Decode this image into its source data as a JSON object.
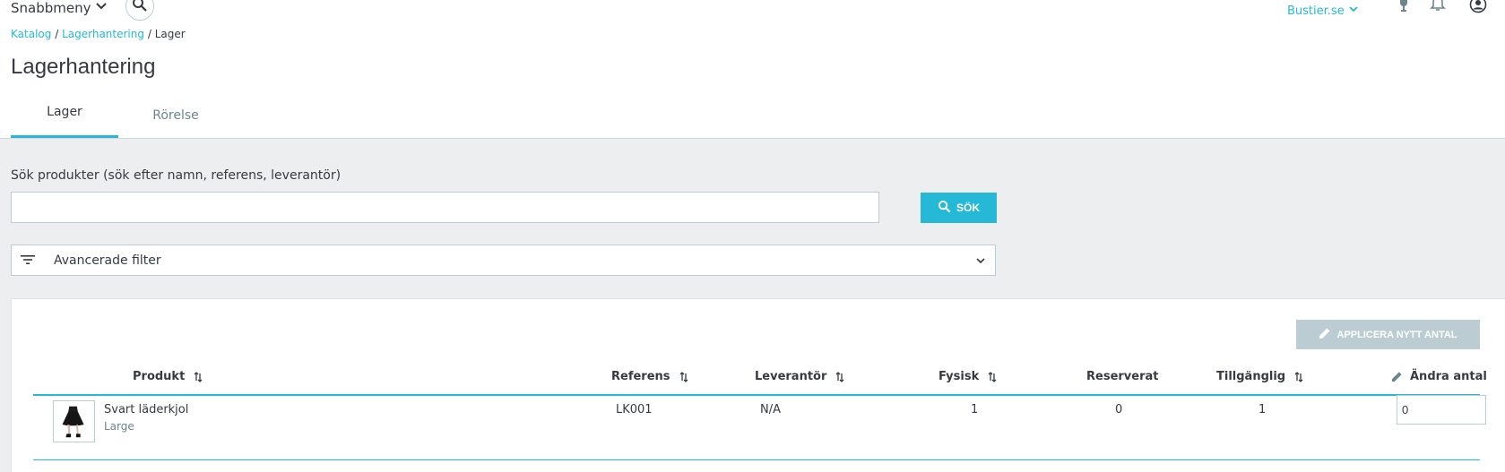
{
  "header": {
    "quick_menu_label": "Snabbmeny",
    "shop_name": "Bustier.se"
  },
  "breadcrumb": {
    "item1": "Katalog",
    "item2": "Lagerhantering",
    "current": "Lager",
    "separator": "/"
  },
  "page": {
    "title": "Lagerhantering"
  },
  "tabs": [
    {
      "label": "Lager",
      "active": true
    },
    {
      "label": "Rörelse",
      "active": false
    }
  ],
  "search": {
    "label": "Sök produkter (sök efter namn, referens, leverantör)",
    "value": "",
    "placeholder": "",
    "button_label": "Sök"
  },
  "filter": {
    "label": "Avancerade filter"
  },
  "actions": {
    "apply_label": "APPLICERA NYTT ANTAL"
  },
  "table": {
    "columns": {
      "product": "Produkt",
      "reference": "Referens",
      "supplier": "Leverantör",
      "physical": "Fysisk",
      "reserved": "Reserverat",
      "available": "Tillgänglig",
      "edit_qty": "Ändra antal"
    },
    "rows": [
      {
        "name": "Svart läderkjol",
        "attribute": "Large",
        "reference": "LK001",
        "supplier": "N/A",
        "physical": "1",
        "reserved": "0",
        "available": "1",
        "new_qty": "0"
      }
    ]
  },
  "colors": {
    "accent": "#25b9d7",
    "background": "#eceeef",
    "disabled_button": "#bbcdd2",
    "text": "#363a41"
  },
  "icons": [
    "chevron-down-icon",
    "search-icon",
    "user-icon",
    "bell-icon",
    "trophy-icon",
    "filter-icon",
    "pencil-icon",
    "sort-icon"
  ]
}
